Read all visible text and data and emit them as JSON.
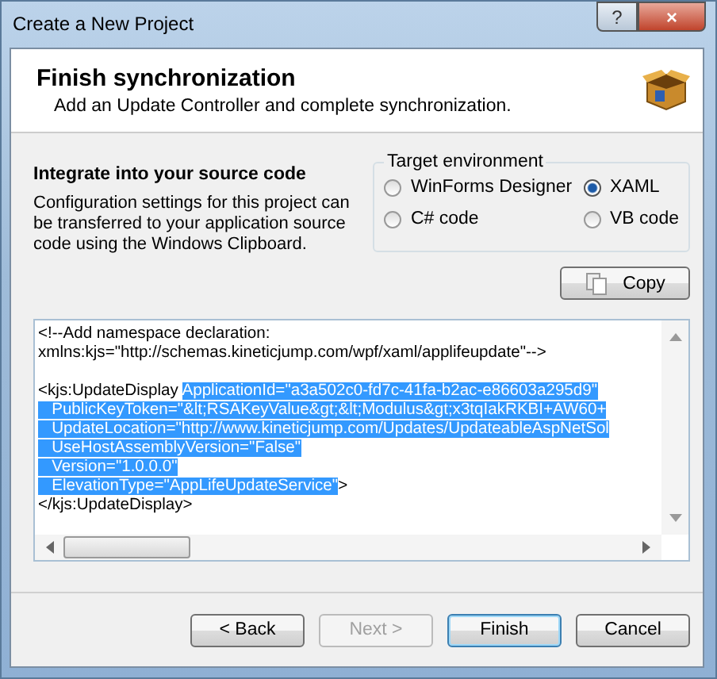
{
  "window": {
    "title": "Create a New Project",
    "buttons": [
      "?",
      "×"
    ]
  },
  "header": {
    "title": "Finish synchronization",
    "subtitle": "Add an Update Controller and complete synchronization."
  },
  "section": {
    "title": "Integrate into your source code",
    "description": "Configuration settings for this project can be transferred to your application source code using the Windows Clipboard."
  },
  "target_environment": {
    "label": "Target environment",
    "options": [
      {
        "label": "WinForms Designer",
        "selected": false
      },
      {
        "label": "XAML",
        "selected": true
      },
      {
        "label": "C# code",
        "selected": false
      },
      {
        "label": "VB code",
        "selected": false
      }
    ]
  },
  "copy_button": "Copy",
  "code": {
    "blocks": [
      {
        "lines": [
          {
            "segments": [
              {
                "text": "<!--Add namespace declaration:",
                "selected": false
              }
            ]
          },
          {
            "segments": [
              {
                "text": "xmlns:kjs=\"http://schemas.kineticjump.com/wpf/xaml/applifeupdate\"-->",
                "selected": false
              }
            ]
          }
        ]
      },
      {
        "lines": [
          {
            "segments": [
              {
                "text": "<kjs:UpdateDisplay ",
                "selected": false
              },
              {
                "text": "ApplicationId=\"a3a502c0-fd7c-41fa-b2ac-e86603a295d9\"",
                "selected": true
              }
            ]
          },
          {
            "segments": [
              {
                "text": "   PublicKeyToken=\"&lt;RSAKeyValue&gt;&lt;Modulus&gt;x3tqIakRKBI+AW60+",
                "selected": true
              }
            ]
          },
          {
            "segments": [
              {
                "text": "   UpdateLocation=\"http://www.kineticjump.com/Updates/UpdateableAspNetSol",
                "selected": true
              }
            ]
          },
          {
            "segments": [
              {
                "text": "   UseHostAssemblyVersion=\"False\"",
                "selected": true
              }
            ]
          },
          {
            "segments": [
              {
                "text": "   Version=\"1.0.0.0\"",
                "selected": true
              }
            ]
          },
          {
            "segments": [
              {
                "text": "   ElevationType=\"AppLifeUpdateService\"",
                "selected": true
              },
              {
                "text": ">",
                "selected": false
              }
            ]
          },
          {
            "segments": [
              {
                "text": "</kjs:UpdateDisplay>",
                "selected": false
              }
            ]
          }
        ]
      }
    ]
  },
  "buttons": [
    {
      "label": "< Back",
      "disabled": false,
      "default": false
    },
    {
      "label": "Next >",
      "disabled": true,
      "default": false
    },
    {
      "label": "Finish",
      "disabled": false,
      "default": true
    },
    {
      "label": "Cancel",
      "disabled": false,
      "default": false
    }
  ]
}
